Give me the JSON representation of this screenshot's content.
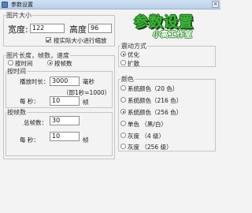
{
  "window": {
    "title": "参数设置",
    "close_glyph": "×"
  },
  "logo": {
    "main": "参数设置",
    "sub": "小高工作室"
  },
  "image_size": {
    "title": "图片大小",
    "width_label": "宽度:",
    "width_value": "122",
    "height_label": "高度",
    "height_value": "96",
    "scale_label": "按实际大小进行缩放",
    "scale_checked": true
  },
  "length_group": {
    "title": "图片长度，帧数，速度",
    "mode_time_label": "按时间",
    "mode_frames_label": "按帧数",
    "selected_mode": "frames",
    "by_time": {
      "title": "按时间",
      "duration_label": "播放时长：",
      "duration_value": "3000",
      "duration_unit": "毫秒",
      "duration_hint": "（即1秒=1000）",
      "per_sec_label": "每  秒：",
      "per_sec_value": "10",
      "per_sec_unit": "帧"
    },
    "by_frames": {
      "title": "按帧数",
      "total_label": "总帧数：",
      "total_value": "30",
      "per_sec_label": "每  秒：",
      "per_sec_value": "10",
      "per_sec_unit": "帧"
    }
  },
  "dither": {
    "title": "震动方式",
    "options": [
      "优化",
      "扩散"
    ],
    "selected": 0
  },
  "colors": {
    "title": "颜色",
    "options": [
      "系统颜色（20 色）",
      "系统颜色（216 色）",
      "系统颜色（256 色）",
      "单色 （黑/白）",
      "灰度 （4 级）",
      "灰度 （256 级）"
    ],
    "selected": 2
  }
}
